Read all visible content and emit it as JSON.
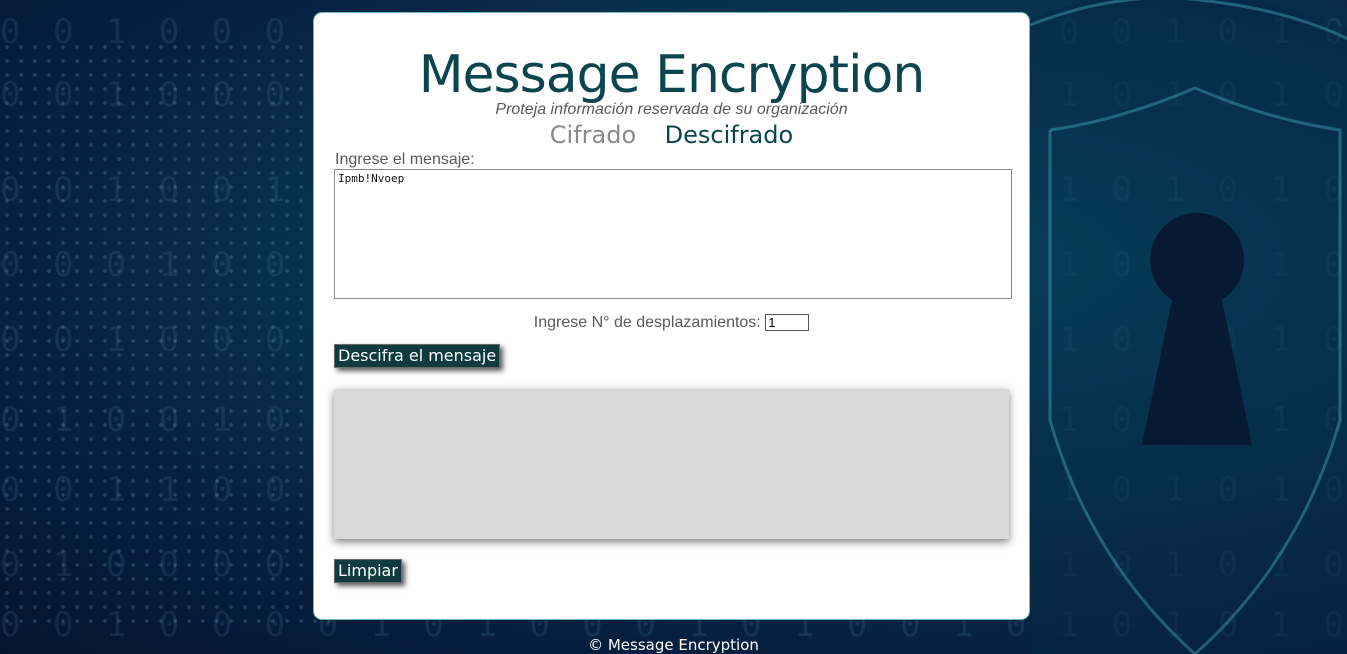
{
  "header": {
    "title": "Message Encryption",
    "subtitle": "Proteja información reservada de su organización"
  },
  "tabs": [
    {
      "label": "Cifrado",
      "active": false
    },
    {
      "label": "Descifrado",
      "active": true
    }
  ],
  "form": {
    "message_label": "Ingrese el mensaje:",
    "message_value": "Ipmb!Nvoep",
    "shift_label": "Ingrese N° de desplazamientos:",
    "shift_value": "1",
    "decrypt_button": "Descifra el mensaje",
    "result_text": "",
    "clear_button": "Limpiar"
  },
  "footer": {
    "text": "© Message Encryption"
  },
  "colors": {
    "brand": "#0b4650",
    "button_bg": "#0e3a40",
    "result_bg": "#d9d9d9",
    "background": "#06203f"
  },
  "icons": {
    "background_art": "shield-keyhole-icon"
  }
}
